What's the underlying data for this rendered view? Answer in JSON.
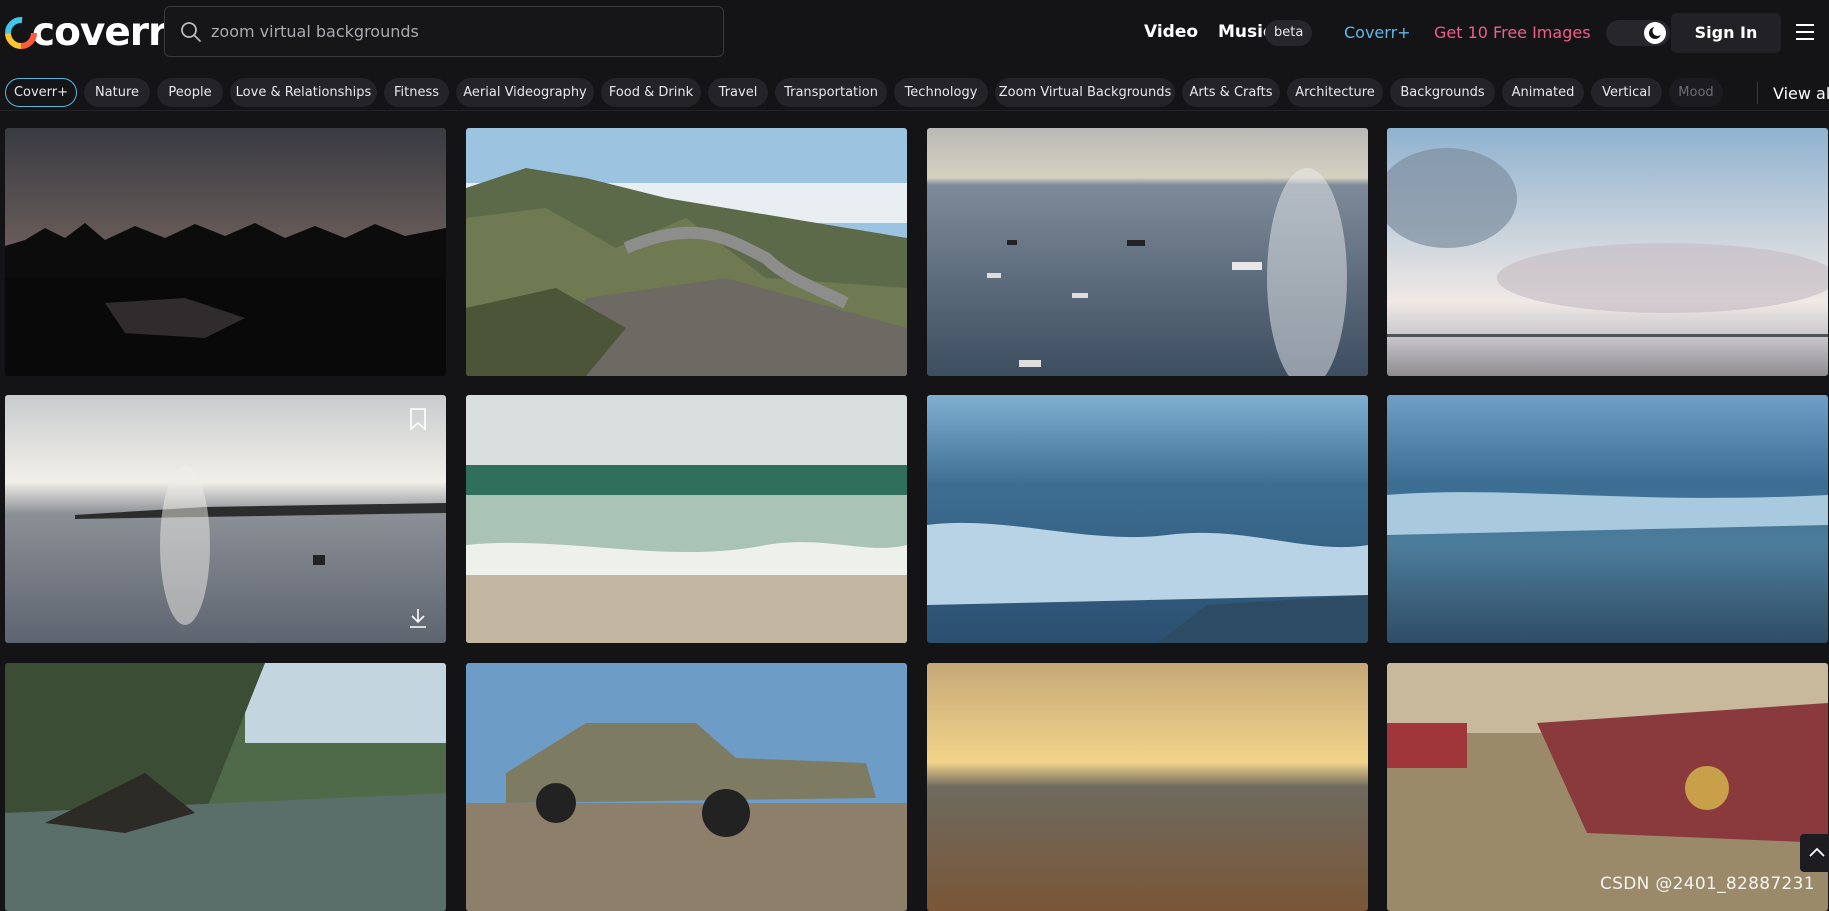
{
  "header": {
    "logo_text": "coverr",
    "search_placeholder": "zoom virtual backgrounds",
    "nav": {
      "video": "Video",
      "music": "Music",
      "beta": "beta",
      "coverr_plus": "Coverr+",
      "free_images": "Get 10 Free Images"
    },
    "sign_in": "Sign In"
  },
  "categories": {
    "items": [
      "Coverr+",
      "Nature",
      "People",
      "Love & Relationships",
      "Fitness",
      "Aerial Videography",
      "Food & Drink",
      "Travel",
      "Transportation",
      "Technology",
      "Zoom Virtual Backgrounds",
      "Arts & Crafts",
      "Architecture",
      "Backgrounds",
      "Animated",
      "Vertical",
      "Mood"
    ],
    "active": "Coverr+",
    "view_all": "View all"
  },
  "watermark": "CSDN @2401_82887231",
  "colors": {
    "background": "#141416",
    "accent_blue": "#5fb7e6",
    "accent_pink": "#ef5f88"
  }
}
